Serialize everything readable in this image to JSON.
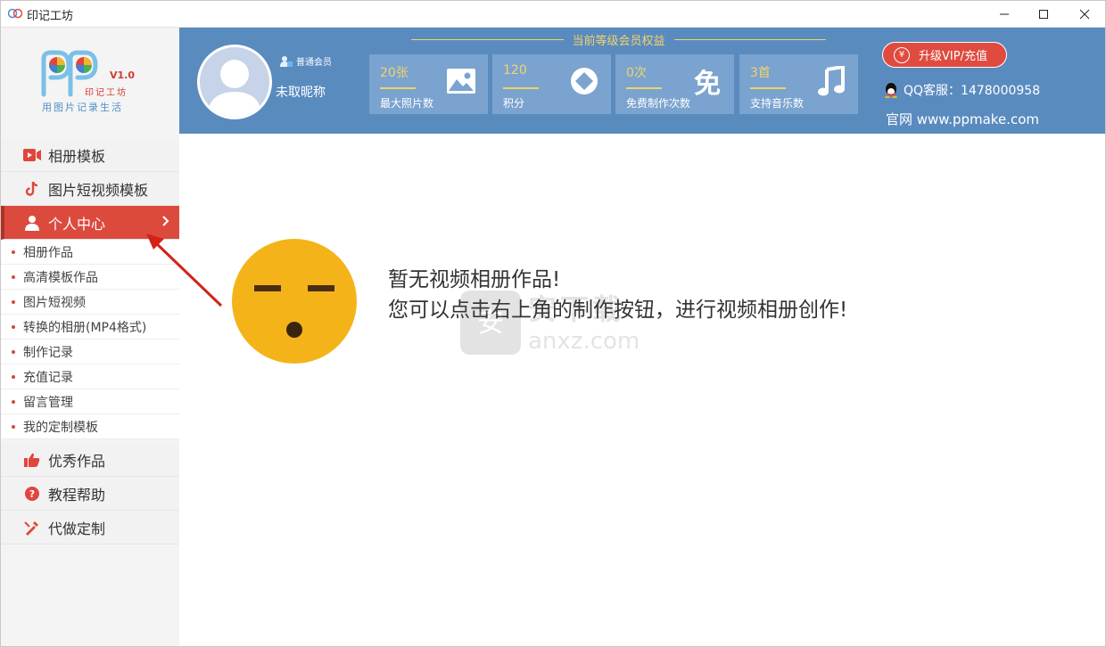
{
  "window": {
    "title": "印记工坊"
  },
  "logo": {
    "brand": "印记工坊",
    "version": "V1.0",
    "slogan": "用图片记录生活"
  },
  "sidebar": {
    "main_items": [
      {
        "label": "相册模板",
        "icon": "video-icon"
      },
      {
        "label": "图片短视频模板",
        "icon": "tiktok-icon"
      },
      {
        "label": "个人中心",
        "icon": "user-icon",
        "active": true
      }
    ],
    "sub_items": [
      "相册作品",
      "高清模板作品",
      "图片短视频",
      "转换的相册(MP4格式)",
      "制作记录",
      "充值记录",
      "留言管理",
      "我的定制模板"
    ],
    "bottom_items": [
      {
        "label": "优秀作品",
        "icon": "thumbs-up-icon"
      },
      {
        "label": "教程帮助",
        "icon": "help-icon"
      },
      {
        "label": "代做定制",
        "icon": "brush-icon"
      }
    ]
  },
  "header": {
    "member_badge": "普通会员",
    "nickname": "未取昵称",
    "benefit_title": "当前等级会员权益",
    "stats": [
      {
        "value": "20张",
        "label": "最大照片数",
        "icon": "image-icon"
      },
      {
        "value": "120",
        "label": "积分",
        "icon": "diamond-icon"
      },
      {
        "value": "0次",
        "label": "免费制作次数",
        "icon": "free-icon",
        "icon_text": "免"
      },
      {
        "value": "3首",
        "label": "支持音乐数",
        "icon": "music-icon"
      }
    ],
    "vip_button": "升级VIP/充值",
    "qq_service": "QQ客服：1478000958",
    "website": "官网 www.ppmake.com"
  },
  "main": {
    "empty_title": "暂无视频相册作品!",
    "empty_hint": "您可以点击右上角的制作按钮，进行视频相册创作!"
  },
  "watermark": {
    "cn": "安下载",
    "domain": "anxz.com"
  },
  "colors": {
    "active_red": "#dc4a3e",
    "header_blue": "#5a8bbf",
    "gold": "#f2d36b",
    "emoji_yellow": "#f4b419"
  }
}
